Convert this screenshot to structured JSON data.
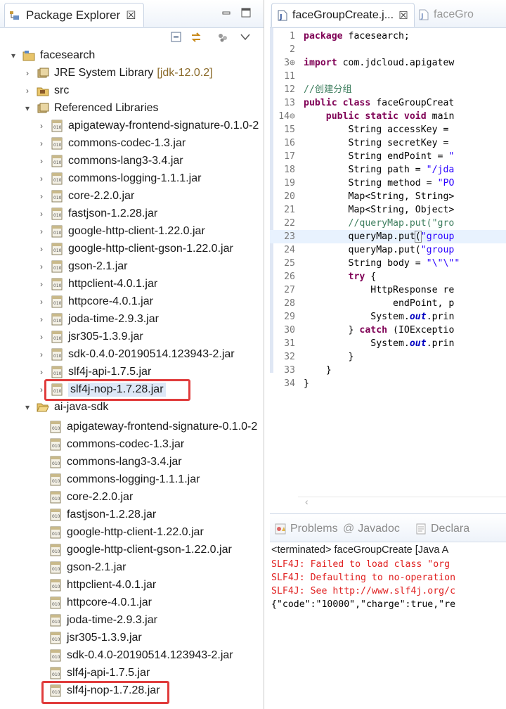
{
  "package_explorer": {
    "title": "Package Explorer",
    "close_glyph": "☒",
    "project1": {
      "name": "facesearch",
      "jre": {
        "label": "JRE System Library",
        "decoration": "[jdk-12.0.2]"
      },
      "src": "src",
      "ref_libs": "Referenced Libraries",
      "jars": [
        "apigateway-frontend-signature-0.1.0-2",
        "commons-codec-1.3.jar",
        "commons-lang3-3.4.jar",
        "commons-logging-1.1.1.jar",
        "core-2.2.0.jar",
        "fastjson-1.2.28.jar",
        "google-http-client-1.22.0.jar",
        "google-http-client-gson-1.22.0.jar",
        "gson-2.1.jar",
        "httpclient-4.0.1.jar",
        "httpcore-4.0.1.jar",
        "joda-time-2.9.3.jar",
        "jsr305-1.3.9.jar",
        "sdk-0.4.0-20190514.123943-2.jar",
        "slf4j-api-1.7.5.jar",
        "slf4j-nop-1.7.28.jar"
      ]
    },
    "folder2": {
      "name": "ai-java-sdk",
      "jars": [
        "apigateway-frontend-signature-0.1.0-2",
        "commons-codec-1.3.jar",
        "commons-lang3-3.4.jar",
        "commons-logging-1.1.1.jar",
        "core-2.2.0.jar",
        "fastjson-1.2.28.jar",
        "google-http-client-1.22.0.jar",
        "google-http-client-gson-1.22.0.jar",
        "gson-2.1.jar",
        "httpclient-4.0.1.jar",
        "httpcore-4.0.1.jar",
        "joda-time-2.9.3.jar",
        "jsr305-1.3.9.jar",
        "sdk-0.4.0-20190514.123943-2.jar",
        "slf4j-api-1.7.5.jar",
        "slf4j-nop-1.7.28.jar"
      ]
    }
  },
  "editor": {
    "tabs": [
      {
        "label": "faceGroupCreate.j...",
        "active": true
      },
      {
        "label": "faceGro",
        "active": false
      }
    ],
    "lines": [
      {
        "n": "1",
        "code": [
          [
            "kw",
            "package"
          ],
          [
            "",
            "facesearch;"
          ]
        ]
      },
      {
        "n": "2",
        "code": []
      },
      {
        "n": "3⊕",
        "code": [
          [
            "kw",
            "import"
          ],
          [
            "",
            "com.jdcloud.apigatew"
          ]
        ]
      },
      {
        "n": "11",
        "code": []
      },
      {
        "n": "12",
        "code": [
          [
            "cm",
            "//创建分组"
          ]
        ]
      },
      {
        "n": "13",
        "code": [
          [
            "kw",
            "public class"
          ],
          [
            "",
            "faceGroupCreat"
          ]
        ]
      },
      {
        "n": "14⊖",
        "code": [
          [
            "",
            "    "
          ],
          [
            "kw",
            "public static void"
          ],
          [
            "",
            "main"
          ]
        ]
      },
      {
        "n": "15",
        "code": [
          [
            "",
            "        String accessKey = "
          ]
        ]
      },
      {
        "n": "16",
        "code": [
          [
            "",
            "        String secretKey = "
          ]
        ]
      },
      {
        "n": "17",
        "code": [
          [
            "",
            "        String endPoint = "
          ],
          [
            "str",
            "\""
          ]
        ]
      },
      {
        "n": "18",
        "code": [
          [
            "",
            "        String path = "
          ],
          [
            "str",
            "\"/jda"
          ]
        ]
      },
      {
        "n": "19",
        "code": [
          [
            "",
            "        String method = "
          ],
          [
            "str",
            "\"PO"
          ]
        ]
      },
      {
        "n": "20",
        "code": [
          [
            "",
            "        Map<String, String>"
          ]
        ]
      },
      {
        "n": "21",
        "code": [
          [
            "",
            "        Map<String, Object>"
          ]
        ]
      },
      {
        "n": "22",
        "code": [
          [
            "cm",
            "        //queryMap.put(\"gro"
          ]
        ]
      },
      {
        "n": "23",
        "code": [
          [
            "",
            "        queryMap.put"
          ],
          [
            "bracket",
            "("
          ],
          [
            "str",
            "\"group"
          ]
        ],
        "current": true
      },
      {
        "n": "24",
        "code": [
          [
            "",
            "        queryMap.put("
          ],
          [
            "str",
            "\"group"
          ]
        ]
      },
      {
        "n": "25",
        "code": [
          [
            "",
            "        String body = "
          ],
          [
            "str",
            "\"\\\"\\\"\""
          ]
        ]
      },
      {
        "n": "26",
        "code": [
          [
            "",
            "        "
          ],
          [
            "kw",
            "try"
          ],
          [
            "",
            " {"
          ]
        ]
      },
      {
        "n": "27",
        "code": [
          [
            "",
            "            HttpResponse re"
          ]
        ]
      },
      {
        "n": "28",
        "code": [
          [
            "",
            "                endPoint, p"
          ]
        ]
      },
      {
        "n": "29",
        "code": [
          [
            "",
            "            System."
          ],
          [
            "it",
            "out"
          ],
          [
            "",
            ".prin"
          ]
        ]
      },
      {
        "n": "30",
        "code": [
          [
            "",
            "        } "
          ],
          [
            "kw",
            "catch"
          ],
          [
            "",
            " (IOExceptio"
          ]
        ]
      },
      {
        "n": "31",
        "code": [
          [
            "",
            "            System."
          ],
          [
            "it",
            "out"
          ],
          [
            "",
            ".prin"
          ]
        ]
      },
      {
        "n": "32",
        "code": [
          [
            "",
            "        }"
          ]
        ]
      },
      {
        "n": "33",
        "code": [
          [
            "",
            "    }"
          ]
        ]
      },
      {
        "n": "34",
        "code": [
          [
            "",
            "}"
          ]
        ]
      }
    ]
  },
  "console": {
    "tabs": [
      "Problems",
      "Javadoc",
      "Declara"
    ],
    "terminated": "<terminated> faceGroupCreate [Java A",
    "lines": [
      {
        "cls": "err",
        "text": "SLF4J: Failed to load class \"org"
      },
      {
        "cls": "err",
        "text": "SLF4J: Defaulting to no-operation"
      },
      {
        "cls": "err",
        "text": "SLF4J: See http://www.slf4j.org/c"
      },
      {
        "cls": "out",
        "text": "{\"code\":\"10000\",\"charge\":true,\"re"
      }
    ]
  },
  "colors": {
    "highlight_box": "#e03c3c",
    "keyword": "#7f0055",
    "string": "#2a00ff",
    "comment": "#3f7f5f",
    "error": "#e02020"
  }
}
